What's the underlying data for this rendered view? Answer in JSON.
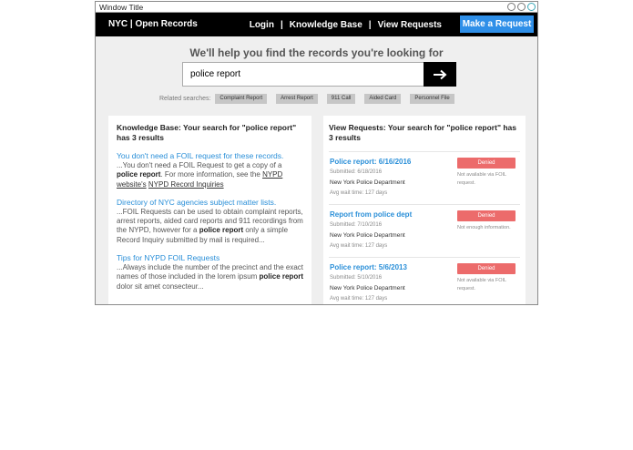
{
  "window": {
    "title": "Window Title"
  },
  "nav": {
    "brand": "NYC | Open Records",
    "links": [
      "Login",
      "Knowledge Base",
      "View Requests"
    ],
    "separator": "|",
    "cta": "Make a Request"
  },
  "hero": {
    "title": "We'll help you find the records you're looking for",
    "search_value": "police report",
    "search_button_icon": "arrow-right-icon"
  },
  "related": {
    "label": "Related searches:",
    "chips": [
      "Complaint Report",
      "Arrest Report",
      "911 Call",
      "Aided Card",
      "Personnel File"
    ]
  },
  "knowledge_base": {
    "heading": "Knowledge Base: Your search for \"police report\" has 3 results",
    "items": [
      {
        "title": "You don't need a FOIL request for these records.",
        "d1": "...You don't need a FOIL Request to get a copy of a ",
        "b1": "police report",
        "d2": ". For more information, see the ",
        "l1": "NYPD website's",
        "d3": " ",
        "l2": "NYPD Record Inquiries"
      },
      {
        "title": "Directory of NYC agencies subject matter lists.",
        "d1": "...FOIL Requests can be used to obtain complaint reports, arrest reports, aided card reports and 911 recordings from the NYPD, however for a ",
        "b1": "police report",
        "d2": " only a simple Record Inquiry submitted by mail is required..."
      },
      {
        "title": "Tips for NYPD FOIL Requests",
        "d1": "...Always include the number of the precinct and the exact names of those included in the lorem ipsum ",
        "b1": "police report",
        "d2": " dolor sit amet consecteur..."
      }
    ]
  },
  "requests": {
    "heading": "View Requests: Your search for \"police report\" has 3 results",
    "items": [
      {
        "title": "Police report: 6/16/2016",
        "submitted": "Submitted: 6/18/2016",
        "dept": "New York Police Department",
        "wait": "Avg wait time: 127 days",
        "status": "Denied",
        "note": "Not available via FOIL request."
      },
      {
        "title": "Report from police dept",
        "submitted": "Submitted: 7/10/2016",
        "dept": "New York Police Department",
        "wait": "Avg wait time: 127 days",
        "status": "Denied",
        "note": "Not enough information."
      },
      {
        "title": "Police report: 5/6/2013",
        "submitted": "Submitted: 5/10/2016",
        "dept": "New York Police Department",
        "wait": "Avg wait time: 127 days",
        "status": "Denied",
        "note": "Not available via FOIL request."
      }
    ]
  },
  "colors": {
    "accent": "#2f8fe8",
    "link": "#2a8fd8",
    "denied": "#ec6b6b",
    "navbar": "#000000"
  }
}
